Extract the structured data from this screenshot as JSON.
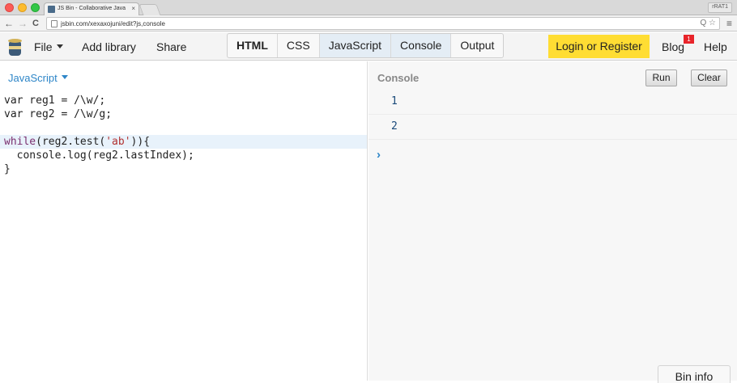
{
  "browser": {
    "tab_title": "JS Bin - Collaborative Java",
    "tab_close": "×",
    "user_badge": "rRAT1",
    "back": "←",
    "forward": "→",
    "reload": "C",
    "url": "jsbin.com/xexaxojuni/edit?js,console",
    "url_icons": "Q ☆",
    "menu": "≡"
  },
  "toolbar": {
    "file": "File",
    "add_library": "Add library",
    "share": "Share",
    "panels": [
      "HTML",
      "CSS",
      "JavaScript",
      "Console",
      "Output"
    ],
    "login": "Login or Register",
    "blog": "Blog",
    "blog_badge": "1",
    "help": "Help"
  },
  "editor": {
    "language": "JavaScript",
    "lines": {
      "l1": "var reg1 = /\\w/;",
      "l2": "var reg2 = /\\w/g;",
      "l3": "",
      "l4_kw": "while",
      "l4_a": "(reg2.test(",
      "l4_str": "'ab'",
      "l4_b": ")){",
      "l5": "  console.log(reg2.lastIndex);",
      "l6": "}"
    }
  },
  "console": {
    "title": "Console",
    "run": "Run",
    "clear": "Clear",
    "outputs": [
      "1",
      "2"
    ],
    "prompt": "›"
  },
  "bin_info": "Bin info"
}
